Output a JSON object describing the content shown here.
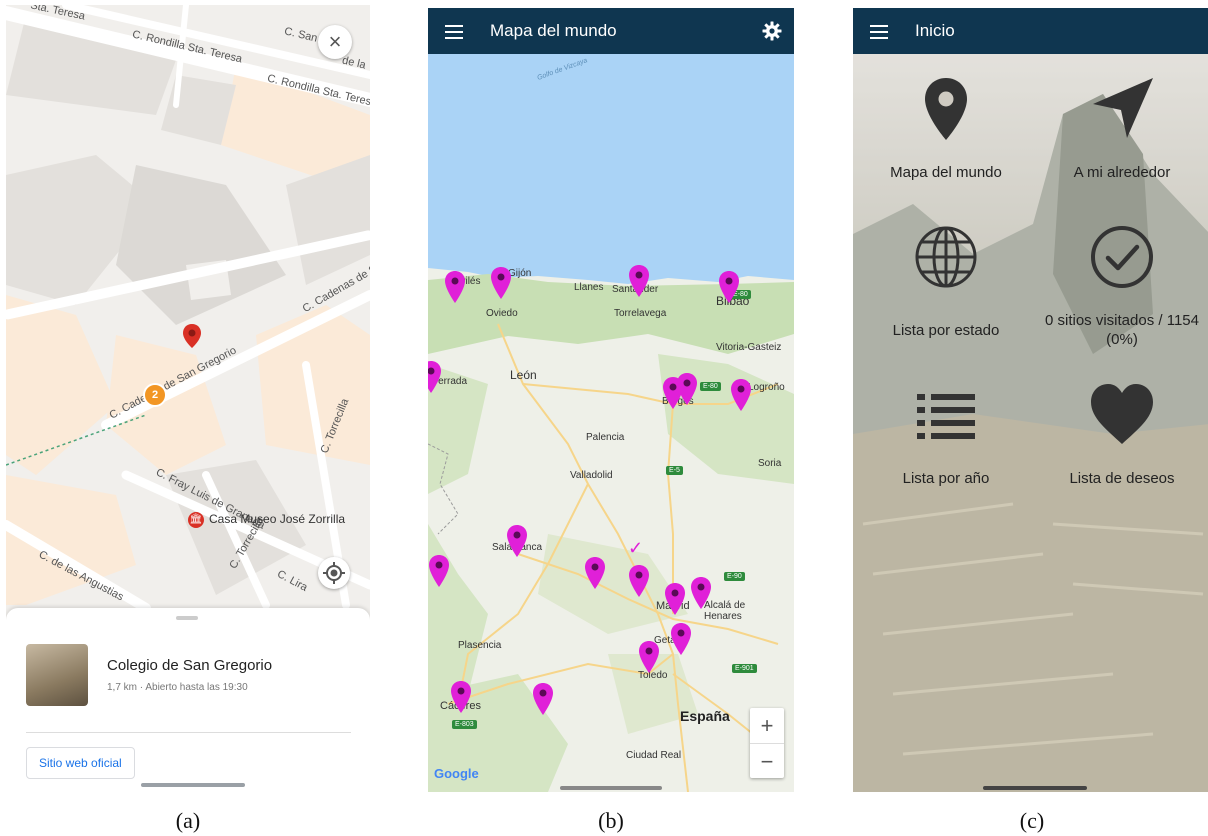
{
  "panel_a": {
    "streets": [
      "Sta. Teresa",
      "C. Rondilla Sta. Teresa",
      "C. Rondilla Sta. Teresa",
      "C. San",
      "de la",
      "C. Cadenas de S",
      "C. Cadenas de San Gregorio",
      "C. Torrecilla",
      "C. Fray Luis de Granada",
      "C. de las Angustias",
      "C. Torrecilla",
      "C. Lira"
    ],
    "poi_label": "Casa Museo José Zorrilla",
    "cluster_count": "2",
    "close_label": "×",
    "place": {
      "name": "Colegio de San Gregorio",
      "details": "1,7 km · Abierto hasta las 19:30",
      "website_button": "Sitio web oficial"
    },
    "icons": {
      "close": "close-icon",
      "locate": "my-location-icon",
      "pin": "map-pin-icon",
      "poi": "museum-icon"
    },
    "colors": {
      "pin": "#d93025",
      "cluster": "#f29624",
      "link": "#1a73e8"
    }
  },
  "panel_b": {
    "app_title": "Mapa del mundo",
    "sea_label": "Golfo de Vizcaya",
    "cities": [
      "Avilés",
      "Gijón",
      "Llanes",
      "Santander",
      "Bilbao",
      "Oviedo",
      "Torrelavega",
      "Vitoria-Gasteiz",
      "Ferrada",
      "León",
      "Burgos",
      "Logroño",
      "Palencia",
      "Soria",
      "Valladolid",
      "Salamanca",
      "Madrid",
      "Alcalá de Henares",
      "Getafe",
      "Plasencia",
      "Toledo",
      "Cáceres",
      "Ciudad Real"
    ],
    "country_label": "España",
    "shields": [
      "E-80",
      "E-80",
      "E-5",
      "E-90",
      "E-901",
      "E-803"
    ],
    "zoom_in": "+",
    "zoom_out": "−",
    "attribution": "Google",
    "check_mark": "✓",
    "marker_count": 18,
    "icons": {
      "menu": "menu-icon",
      "settings": "gear-icon",
      "marker": "map-marker-icon"
    },
    "colors": {
      "appbar": "#0f3650",
      "marker": "#e020d8",
      "sea": "#aad3f6"
    }
  },
  "panel_c": {
    "app_title": "Inicio",
    "tiles": [
      {
        "label": "Mapa del mundo",
        "icon": "map-pin-icon"
      },
      {
        "label": "A mi alrededor",
        "icon": "navigation-arrow-icon"
      },
      {
        "label": "Lista por estado",
        "icon": "globe-icon"
      },
      {
        "label": "0 sitios visitados / 1154 (0%)",
        "icon": "check-circle-icon"
      },
      {
        "label": "Lista por año",
        "icon": "list-icon"
      },
      {
        "label": "Lista de deseos",
        "icon": "heart-icon"
      }
    ],
    "icons": {
      "menu": "menu-icon"
    },
    "colors": {
      "appbar": "#0f3650"
    }
  },
  "captions": [
    "(a)",
    "(b)",
    "(c)"
  ]
}
